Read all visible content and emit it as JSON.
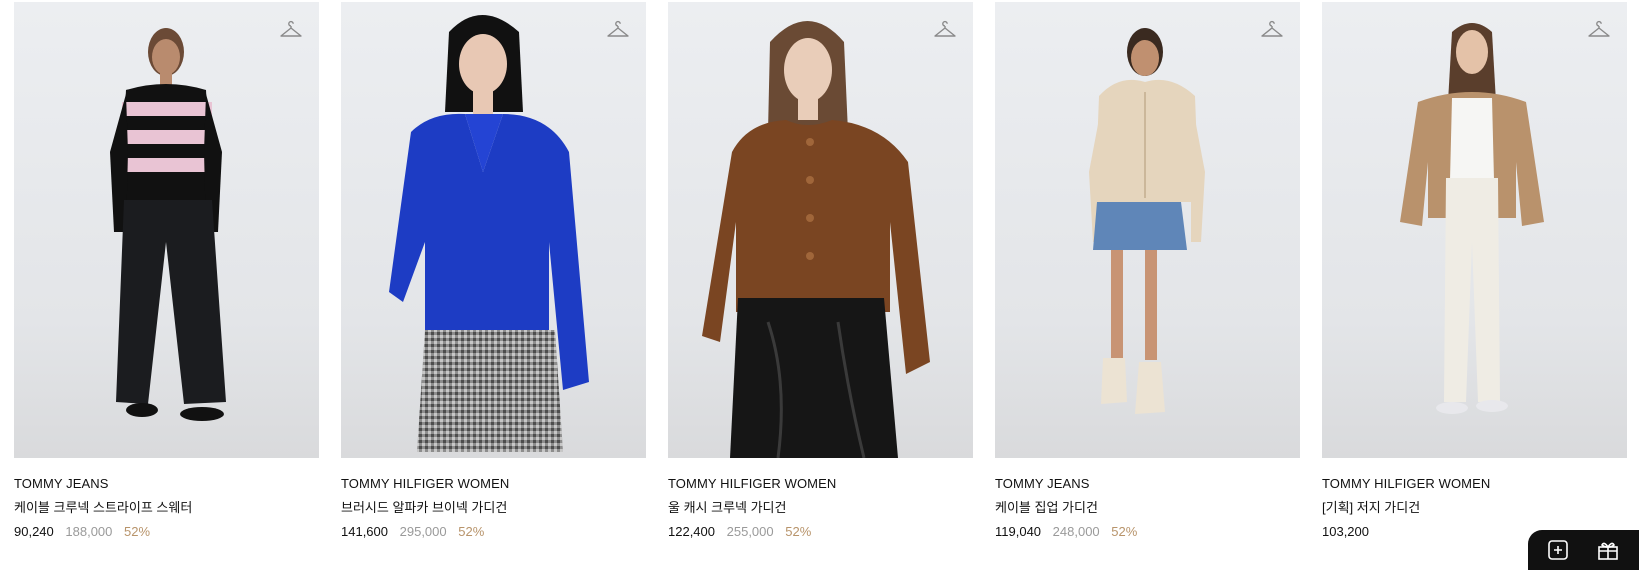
{
  "products": [
    {
      "brand": "TOMMY JEANS",
      "name": "케이블 크루넥 스트라이프 스웨터",
      "price": "90,240",
      "original_price": "188,000",
      "discount": "52%"
    },
    {
      "brand": "TOMMY HILFIGER WOMEN",
      "name": "브러시드 알파카 브이넥 가디건",
      "price": "141,600",
      "original_price": "295,000",
      "discount": "52%"
    },
    {
      "brand": "TOMMY HILFIGER WOMEN",
      "name": "울 캐시 크루넥 가디건",
      "price": "122,400",
      "original_price": "255,000",
      "discount": "52%"
    },
    {
      "brand": "TOMMY JEANS",
      "name": "케이블 집업 가디건",
      "price": "119,040",
      "original_price": "248,000",
      "discount": "52%"
    },
    {
      "brand": "TOMMY HILFIGER WOMEN",
      "name": "[기획] 저지 가디건",
      "price": "103,200",
      "original_price": "",
      "discount": ""
    }
  ],
  "icons": {
    "wishlist": "hanger-icon",
    "floating": [
      "add-icon",
      "gift-icon"
    ]
  },
  "colors": {
    "discount": "#b8946b",
    "original_price": "#9a9a9a",
    "text": "#111111"
  }
}
